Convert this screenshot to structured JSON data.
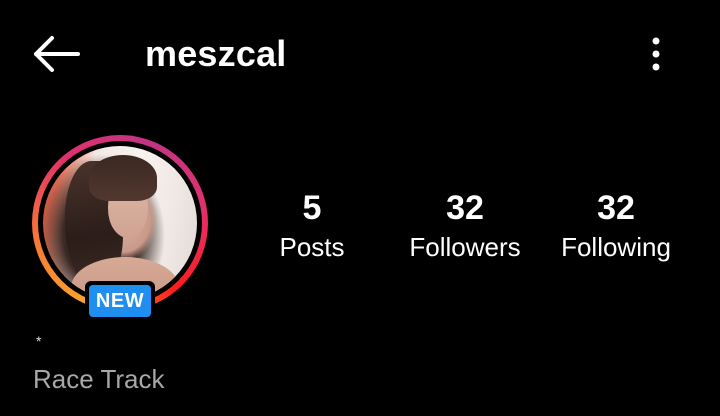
{
  "header": {
    "username": "meszcal",
    "back_icon": "arrow-left-icon",
    "more_icon": "more-vertical-icon"
  },
  "profile": {
    "avatar_ring_colors": [
      "#f9a62a",
      "#f77737",
      "#e1306c",
      "#c13584"
    ],
    "new_badge_label": "NEW",
    "new_badge_color": "#1f8ef1"
  },
  "stats": {
    "posts": {
      "value": "5",
      "label": "Posts"
    },
    "followers": {
      "value": "32",
      "label": "Followers"
    },
    "following": {
      "value": "32",
      "label": "Following"
    }
  },
  "bio": {
    "line": "*",
    "category": "Race Track"
  }
}
